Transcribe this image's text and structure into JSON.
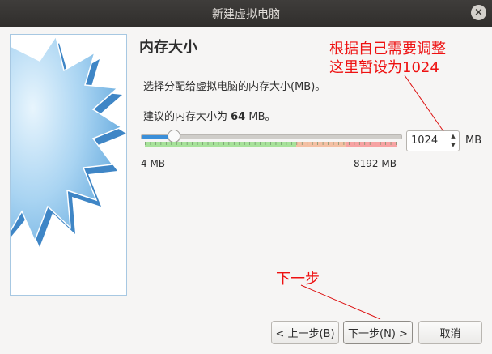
{
  "window": {
    "title": "新建虚拟电脑",
    "close_glyph": "×"
  },
  "page": {
    "title": "内存大小",
    "description": "选择分配给虚拟电脑的内存大小(MB)。",
    "recommend_prefix": "建议的内存大小为 ",
    "recommend_value": "64",
    "recommend_suffix": " MB。"
  },
  "memory": {
    "value": "1024",
    "unit": "MB",
    "min_label": "4 MB",
    "max_label": "8192 MB",
    "slider_fraction": 0.125,
    "range_zones": [
      {
        "name": "safe",
        "from": 0.0,
        "to": 0.6,
        "color": "#a7e29a"
      },
      {
        "name": "warning",
        "from": 0.6,
        "to": 0.8,
        "color": "#f4c0a4"
      },
      {
        "name": "danger",
        "from": 0.8,
        "to": 1.0,
        "color": "#f7a3a3"
      }
    ],
    "accent": "#3b8fd9"
  },
  "annotations": {
    "memory_note": [
      "根据自己需要调整",
      "这里暂设为1024"
    ],
    "next_note": "下一步",
    "color": "#ee1111"
  },
  "buttons": {
    "back": "< 上一步(B)",
    "next": "下一步(N) >",
    "cancel": "取消"
  },
  "icons": {
    "spin_up": "▲",
    "spin_down": "▼"
  }
}
